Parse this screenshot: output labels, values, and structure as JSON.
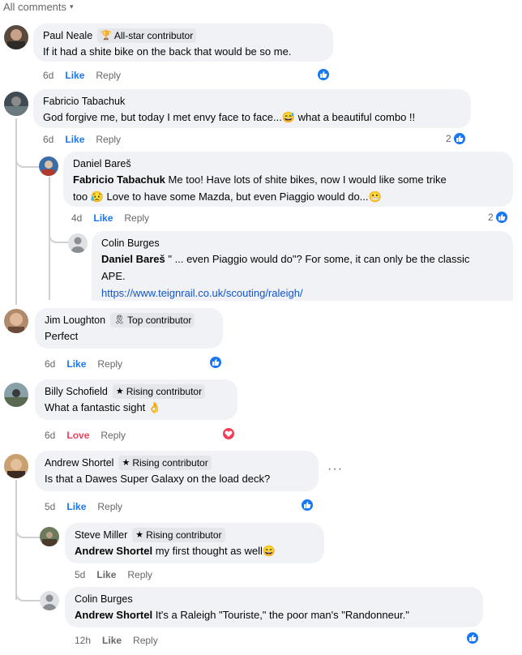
{
  "header": {
    "label": "All comments",
    "caret": "▾"
  },
  "comments": [
    {
      "name": "Paul Neale",
      "badge": "All-star contributor",
      "text": "If it had a shite bike on the back that would be so me.",
      "time": "6d",
      "like": "Like",
      "reply": "Reply"
    },
    {
      "name": "Fabricio Tabachuk",
      "text": "God forgive me, but today I met envy face to face...😅 what a beautiful combo !!",
      "time": "6d",
      "like": "Like",
      "reply": "Reply",
      "react_count": "2"
    },
    {
      "name": "Daniel Bareš",
      "mention": "Fabricio Tabachuk",
      "text": "Me too! Have lots of shite bikes, now I would like some trike",
      "text2": "too 😥 Love to have some Mazda, but even Piaggio would do...😬",
      "time": "4d",
      "like": "Like",
      "reply": "Reply",
      "react_count": "2"
    },
    {
      "name": "Colin Burges",
      "mention": "Daniel Bareš",
      "text": "\" ... even Piaggio would do\"? For some, it can only be the classic",
      "text2": "APE.",
      "link": "https://www.teignrail.co.uk/scouting/raleigh/"
    },
    {
      "name": "Jim Loughton",
      "badge": "Top contributor",
      "text": "Perfect",
      "time": "6d",
      "like": "Like",
      "reply": "Reply"
    },
    {
      "name": "Billy Schofield",
      "badge": "Rising contributor",
      "text": "What a fantastic sight 👌",
      "time": "6d",
      "like": "Love",
      "reply": "Reply"
    },
    {
      "name": "Andrew Shortel",
      "badge": "Rising contributor",
      "text": "Is that a Dawes Super Galaxy on the load deck?",
      "time": "5d",
      "like": "Like",
      "reply": "Reply",
      "more": "···"
    },
    {
      "name": "Steve Miller",
      "badge": "Rising contributor",
      "mention": "Andrew Shortel",
      "text": "my first thought as well😄",
      "time": "5d",
      "like": "Like",
      "reply": "Reply"
    },
    {
      "name": "Colin Burges",
      "mention": "Andrew Shortel",
      "text": "It's a Raleigh \"Touriste,\" the poor man's \"Randonneur.\"",
      "time": "12h",
      "like": "Like",
      "reply": "Reply"
    }
  ],
  "colors": {
    "bubble": "#f0f2f5",
    "like": "#1877f2",
    "love": "#f33e58",
    "meta": "#65676b"
  }
}
